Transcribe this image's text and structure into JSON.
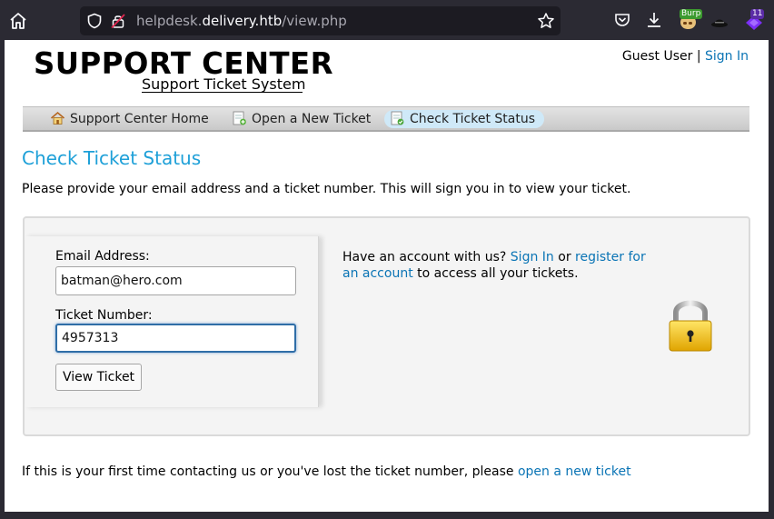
{
  "browser": {
    "url_prefix": "helpdesk.",
    "url_domain": "delivery.htb",
    "url_path": "/view.php",
    "burp_badge": "Burp",
    "ext_badge_count": "11"
  },
  "header": {
    "logo_title": "SUPPORT CENTER",
    "logo_subtitle": "Support Ticket System",
    "guest_label": "Guest User",
    "separator": "|",
    "sign_in": "Sign In"
  },
  "nav": {
    "items": [
      {
        "label": "Support Center Home"
      },
      {
        "label": "Open a New Ticket"
      },
      {
        "label": "Check Ticket Status"
      }
    ]
  },
  "main": {
    "title": "Check Ticket Status",
    "intro": "Please provide your email address and a ticket number. This will sign you in to view your ticket."
  },
  "form": {
    "email_label": "Email Address:",
    "email_value": "batman@hero.com",
    "ticket_label": "Ticket Number:",
    "ticket_value": "4957313",
    "submit_label": "View Ticket"
  },
  "account": {
    "prefix": "Have an account with us?",
    "sign_in": "Sign In",
    "or": "or",
    "register": "register for an account",
    "suffix": "to access all your tickets."
  },
  "footer": {
    "text": "If this is your first time contacting us or you've lost the ticket number, please",
    "link": "open a new ticket"
  },
  "colors": {
    "accent": "#1ea0d8",
    "link": "#0a74b5",
    "browser_bg": "#2b2a33"
  }
}
